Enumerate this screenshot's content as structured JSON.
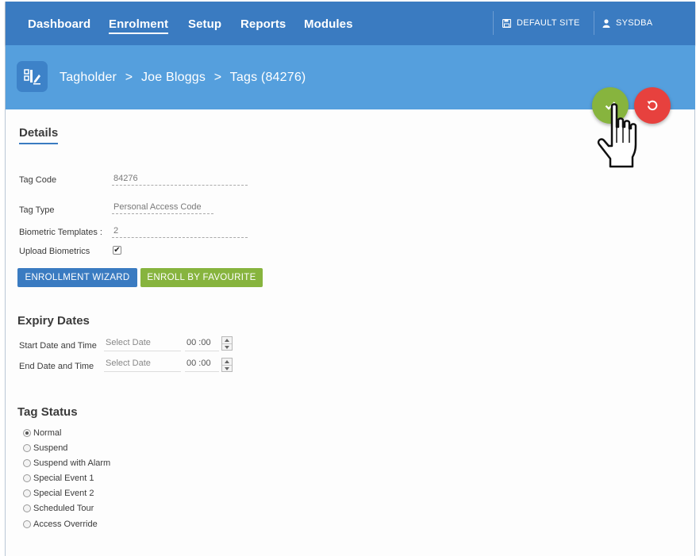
{
  "nav": {
    "items": [
      {
        "label": "Dashboard",
        "active": false
      },
      {
        "label": "Enrolment",
        "active": true
      },
      {
        "label": "Setup",
        "active": false
      },
      {
        "label": "Reports",
        "active": false
      },
      {
        "label": "Modules",
        "active": false
      }
    ],
    "site_label": "DEFAULT SITE",
    "user_label": "SYSDBA"
  },
  "breadcrumb": [
    "Tagholder",
    ">",
    "Joe Bloggs",
    ">",
    "Tags (84276)"
  ],
  "details": {
    "title": "Details",
    "fields": {
      "tag_code_label": "Tag Code",
      "tag_code_value": "84276",
      "tag_type_label": "Tag Type",
      "tag_type_value": "Personal Access Code",
      "bio_templates_label": "Biometric Templates :",
      "bio_templates_value": "2",
      "upload_bio_label": "Upload Biometrics",
      "upload_bio_checked": true
    },
    "buttons": {
      "enroll_wizard": "ENROLLMENT WIZARD",
      "enroll_fav": "ENROLL BY FAVOURITE"
    }
  },
  "expiry": {
    "title": "Expiry Dates",
    "start_label": "Start Date and Time",
    "end_label": "End Date and Time",
    "date_placeholder": "Select Date",
    "start_time": "00 :00",
    "end_time": "00 :00"
  },
  "status": {
    "title": "Tag Status",
    "options": [
      "Normal",
      "Suspend",
      "Suspend with Alarm",
      "Special Event 1",
      "Special Event 2",
      "Scheduled Tour",
      "Access Override"
    ],
    "selected": "Normal"
  },
  "colors": {
    "nav_bg": "#3a7bc1",
    "header_bg": "#559fdd",
    "save": "#87b43e",
    "reset": "#e7413e"
  },
  "icons": [
    "save-disk-icon",
    "user-icon",
    "tag-edit-icon",
    "checkmark-icon",
    "undo-icon",
    "hand-pointer-icon"
  ]
}
